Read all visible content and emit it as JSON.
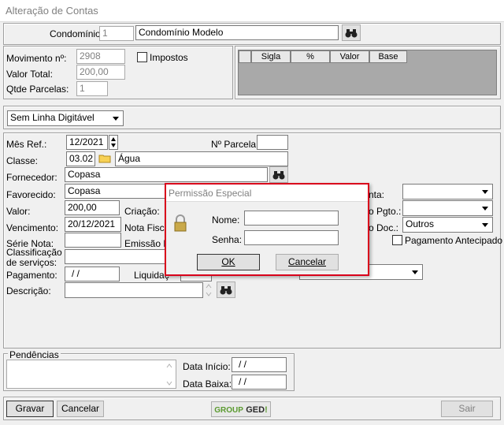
{
  "window": {
    "title": "Alteração de Contas"
  },
  "condominio": {
    "label": "Condomínio:",
    "code": "1",
    "name": "Condomínio Modelo"
  },
  "movimento": {
    "mov_label": "Movimento nº:",
    "mov_value": "2908",
    "valor_label": "Valor Total:",
    "valor_value": "200,00",
    "parcelas_label": "Qtde Parcelas:",
    "parcelas_value": "1",
    "impostos_label": "Impostos"
  },
  "tax_grid": {
    "columns": [
      "",
      "Sigla",
      "%",
      "Valor",
      "Base"
    ]
  },
  "linha_digitavel": {
    "selected": "Sem Linha Digitável"
  },
  "form": {
    "mes_ref_label": "Mês Ref.:",
    "mes_ref_value": "12/2021",
    "parcela_label": "Nº Parcela:",
    "parcela_value": "",
    "classe_label": "Classe:",
    "classe_code": "03.02",
    "classe_name": "Água",
    "fornecedor_label": "Fornecedor:",
    "fornecedor_value": "Copasa",
    "favorecido_label": "Favorecido:",
    "favorecido_value": "Copasa",
    "conta_label": "nta:",
    "valor_label": "Valor:",
    "valor_value": "200,00",
    "criacao_label": "Criação:",
    "tipo_pgto_label": "o Pgto.:",
    "vencimento_label": "Vencimento:",
    "vencimento_value": "20/12/2021",
    "nota_fiscal_label": "Nota Fiscal",
    "tipo_doc_label": "o Doc.:",
    "tipo_doc_value": "Outros",
    "serie_label": "Série Nota:",
    "emissao_label": "Emissão NF",
    "antecipado_label": "Pagamento Antecipado",
    "classificacao_label": "Classificação de serviços:",
    "pagamento_label": "Pagamento:",
    "pagamento_value": "/ /",
    "liquidacao_label": "Liquidaç",
    "descricao_label": "Descrição:"
  },
  "pendencias": {
    "legend": "Pendências",
    "data_inicio_label": "Data Início:",
    "data_inicio_value": "/ /",
    "data_baixa_label": "Data Baixa:",
    "data_baixa_value": "/ /"
  },
  "footer": {
    "gravar": "Gravar",
    "cancelar": "Cancelar",
    "sair": "Sair",
    "logo_group": "GROUP",
    "logo_ged": "GED"
  },
  "dialog": {
    "title": "Permissão Especial",
    "nome_label": "Nome:",
    "senha_label": "Senha:",
    "ok": "OK",
    "cancelar": "Cancelar"
  },
  "colors": {
    "dialog_border": "#d9001b",
    "logo_green": "#5a9a2f"
  }
}
